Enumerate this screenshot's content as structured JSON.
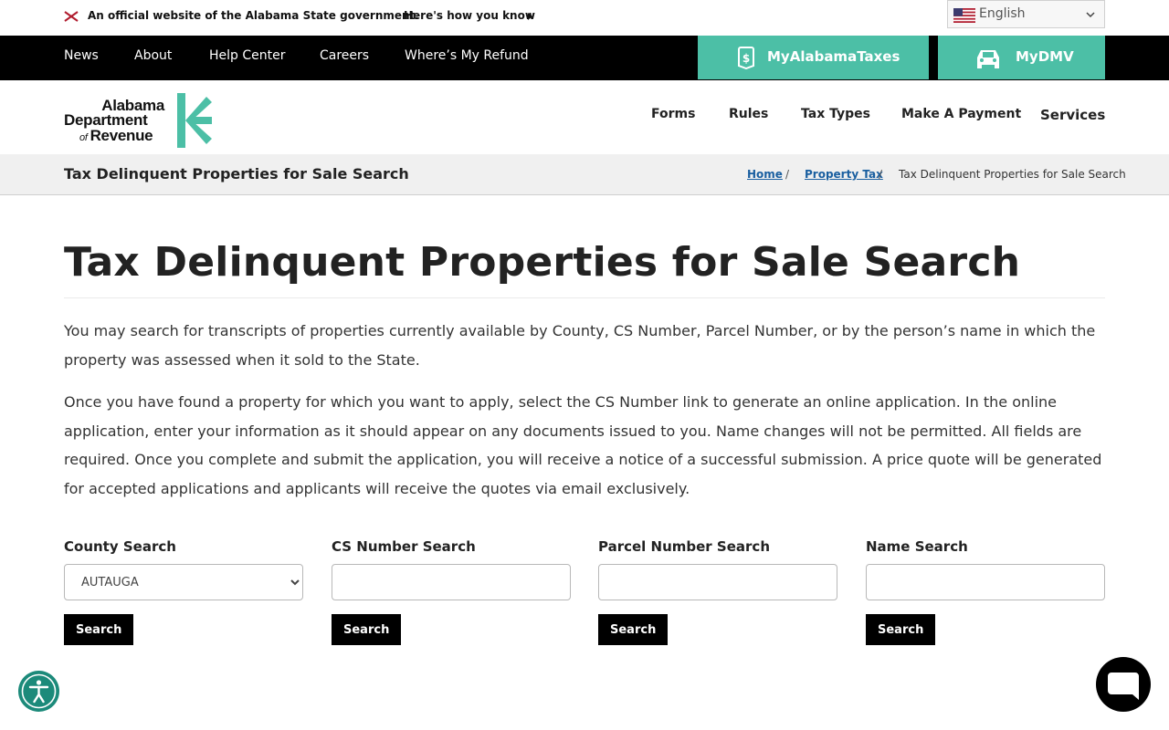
{
  "official": {
    "text": "An official website of the Alabama State government.",
    "how": "Here's how you know"
  },
  "language": {
    "selected": "English",
    "flag_icon": "us-flag-icon"
  },
  "topnav": {
    "items": [
      "News",
      "About",
      "Help Center",
      "Careers",
      "Where’s My Refund"
    ],
    "mytaxes_label": "MyAlabamaTaxes",
    "mydmv_label": "MyDMV",
    "accent": "#4cbfa6"
  },
  "logo": {
    "line1": "Alabama",
    "line2": "Department",
    "line3_prefix": "of",
    "line3": "Revenue"
  },
  "mainnav": {
    "items": [
      "Forms",
      "Rules",
      "Tax Types",
      "Make A Payment",
      "Services"
    ]
  },
  "breadcrumb": {
    "page_name": "Tax Delinquent Properties for Sale Search",
    "home": "Home",
    "property_tax": "Property Tax",
    "current": "Tax Delinquent Properties for Sale Search",
    "separator": "/"
  },
  "main": {
    "title": "Tax Delinquent Properties for Sale Search",
    "para1": "You may search for transcripts of properties currently available by County, CS Number, Parcel Number, or by the person’s name in which the property was assessed when it sold to the State.",
    "para2": "Once you have found a property for which you want to apply, select the CS Number link to generate an online application. In the online application, enter your information as it should appear on any documents issued to you. Name changes will not be permitted. All fields are required. Once you complete and submit the application, you will receive a notice of a successful submission. A price quote will be generated for accepted applications and applicants will receive the quotes via email exclusively."
  },
  "search": {
    "county": {
      "label": "County Search",
      "selected": "AUTAUGA",
      "button": "Search"
    },
    "cs_number": {
      "label": "CS Number Search",
      "value": "",
      "button": "Search"
    },
    "parcel": {
      "label": "Parcel Number Search",
      "value": "",
      "button": "Search"
    },
    "name": {
      "label": "Name Search",
      "value": "",
      "button": "Search"
    }
  }
}
